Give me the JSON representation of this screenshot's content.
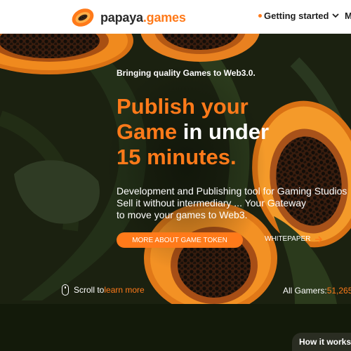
{
  "header": {
    "logo_text_part1": "papaya",
    "logo_text_part2": ".games",
    "nav": {
      "getting_started": "Getting started",
      "more_truncated": "M"
    }
  },
  "hero": {
    "tagline": "Bringing quality Games to Web3.0.",
    "headline": {
      "line1_orange": "Publish your",
      "line2_orange": "Game",
      "line2_white": " in under",
      "line3_orange": "15 minutes."
    },
    "description": {
      "line1": "Development and Publishing tool for Gaming Studios",
      "line2": "Sell it without intermediary ... Your Gateway",
      "line3": "to move your games to Web3."
    },
    "cta_button": "MORE ABOUT GAME TOKEN",
    "whitepaper_link": "WHITEPAPER",
    "scroll_prefix": "Scroll to",
    "scroll_link": "learn more",
    "gamers_label": "All Gamers:",
    "gamers_count": "51,265"
  },
  "footer": {
    "how_it_works": "How it works"
  },
  "colors": {
    "accent": "#ff7a1a",
    "background": "#141a0b",
    "header_bg": "#ffffff"
  },
  "icons": [
    "papaya-logo-icon",
    "dot-icon",
    "chevron-down-icon",
    "arrow-right-icon",
    "mouse-icon"
  ]
}
